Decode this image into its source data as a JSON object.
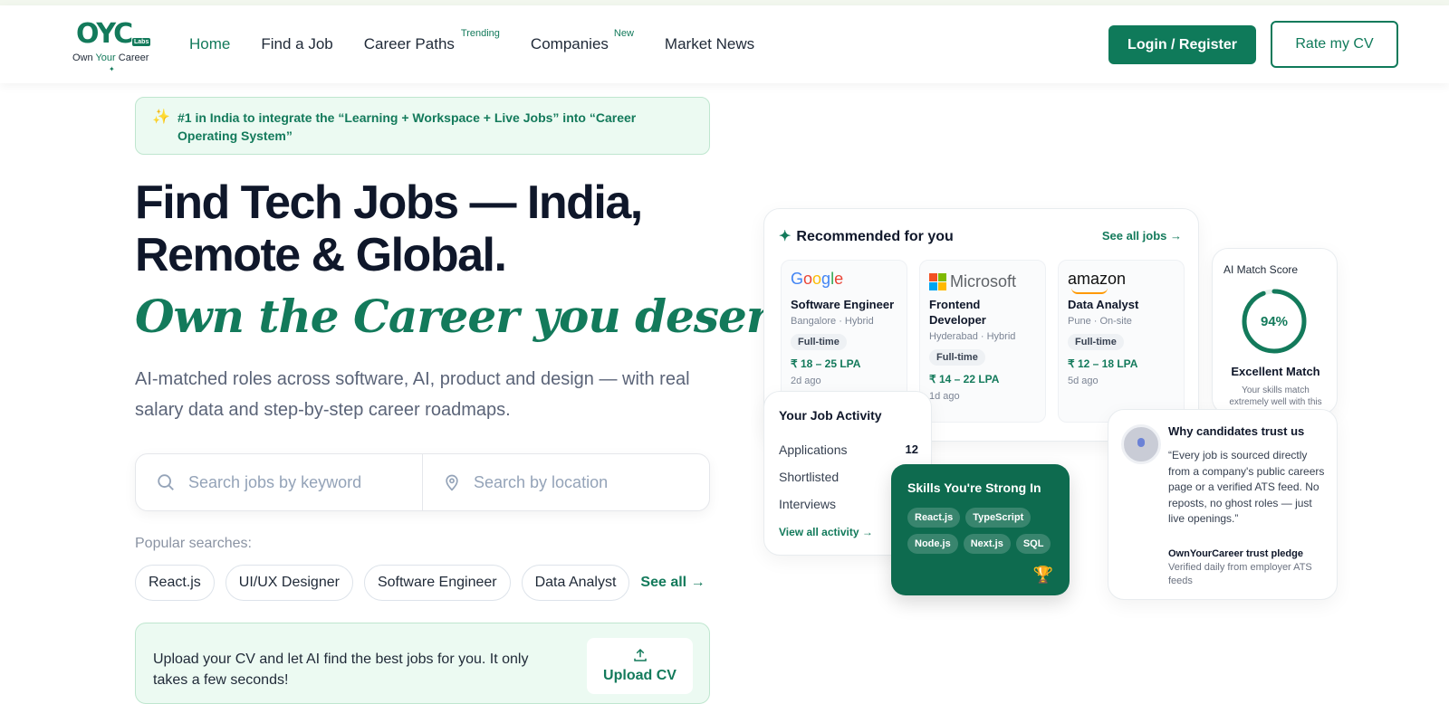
{
  "brand": {
    "mark": "OYC",
    "labs": "Labs",
    "name_part1": "Own ",
    "name_part2": "Your",
    "name_part3": " Career"
  },
  "nav": {
    "home": "Home",
    "find_job": "Find a Job",
    "career_paths": "Career Paths",
    "career_paths_badge": "Trending",
    "companies": "Companies",
    "companies_badge": "New",
    "market_news": "Market News"
  },
  "actions": {
    "login": "Login / Register",
    "rate_cv": "Rate my CV"
  },
  "hero": {
    "banner": "#1 in India to integrate the “Learning + Workspace + Live Jobs” into “Career Operating System”",
    "title_line1": "Find Tech Jobs — India,",
    "title_line2": "Remote & Global.",
    "tagline": "Own the Career you deserve.",
    "subtitle": "AI-matched roles across software, AI, product and design — with real salary data and step-by-step career roadmaps."
  },
  "search": {
    "keyword_placeholder": "Search jobs by keyword",
    "location_placeholder": "Search by location"
  },
  "popular": {
    "label": "Popular searches:",
    "chips": [
      "React.js",
      "UI/UX Designer",
      "Software Engineer",
      "Data Analyst"
    ],
    "see_all": "See all →"
  },
  "upload": {
    "text": "Upload your CV and let AI find the best jobs for you. It only takes a few seconds!",
    "button": "Upload CV"
  },
  "recommended": {
    "title": "Recommended for you",
    "see_all": "See all jobs →",
    "jobs": [
      {
        "company": "Google",
        "role": "Software Engineer",
        "location": "Bangalore · Hybrid",
        "type": "Full-time",
        "salary": "₹ 18 – 25 LPA",
        "posted": "2d ago"
      },
      {
        "company": "Microsoft",
        "role": "Frontend Developer",
        "location": "Hyderabad · Hybrid",
        "type": "Full-time",
        "salary": "₹ 14 – 22 LPA",
        "posted": "1d ago"
      },
      {
        "company": "amazon",
        "role": "Data Analyst",
        "location": "Pune · On-site",
        "type": "Full-time",
        "salary": "₹ 12 – 18 LPA",
        "posted": "5d ago"
      }
    ]
  },
  "match": {
    "title": "AI Match Score",
    "percent_label": "94%",
    "percent_value": 94,
    "verdict": "Excellent Match",
    "desc": "Your skills match extremely well with this"
  },
  "activity": {
    "title": "Your Job Activity",
    "rows": [
      {
        "label": "Applications",
        "value": "12"
      },
      {
        "label": "Shortlisted",
        "value": ""
      },
      {
        "label": "Interviews",
        "value": ""
      }
    ],
    "link": "View all activity →"
  },
  "skills": {
    "title": "Skills You're Strong In",
    "tags": [
      "React.js",
      "TypeScript",
      "Node.js",
      "Next.js",
      "SQL"
    ]
  },
  "trust": {
    "title": "Why candidates trust us",
    "quote": "“Every job is sourced directly from a company's public careers page or a verified ATS feed. No reposts, no ghost roles — just live openings.”",
    "pledge": "OwnYourCareer trust pledge",
    "pledge_desc": "Verified daily from employer ATS feeds"
  },
  "colors": {
    "brand": "#0f7a5a",
    "accent": "#137a5b",
    "banner_bg": "#ecfaf2"
  }
}
